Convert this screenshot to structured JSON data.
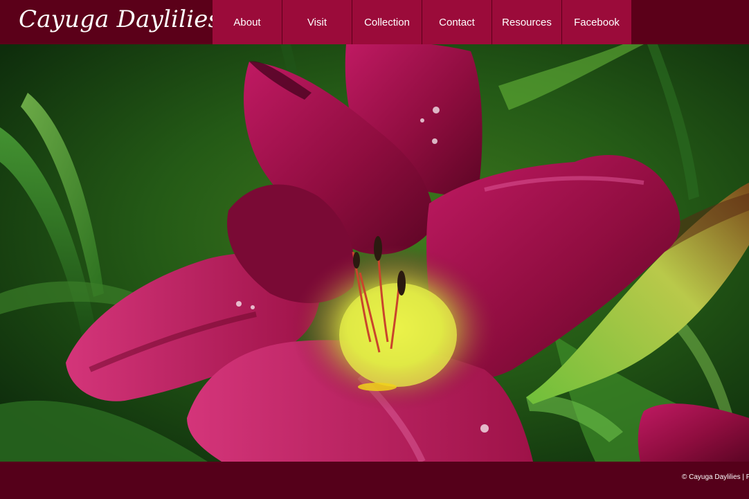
{
  "site": {
    "title": "Cayuga Daylilies"
  },
  "nav": {
    "items": [
      {
        "label": "About"
      },
      {
        "label": "Visit"
      },
      {
        "label": "Collection"
      },
      {
        "label": "Contact"
      },
      {
        "label": "Resources"
      },
      {
        "label": "Facebook"
      }
    ]
  },
  "hero": {
    "subject": "flower-photo"
  },
  "footer": {
    "text": "© Cayuga Daylilies | P"
  },
  "colors": {
    "header_bg": "#5b0019",
    "nav_bg": "#9b0b3a",
    "footer_bg": "#55001a",
    "nav_text": "#ffffff"
  }
}
